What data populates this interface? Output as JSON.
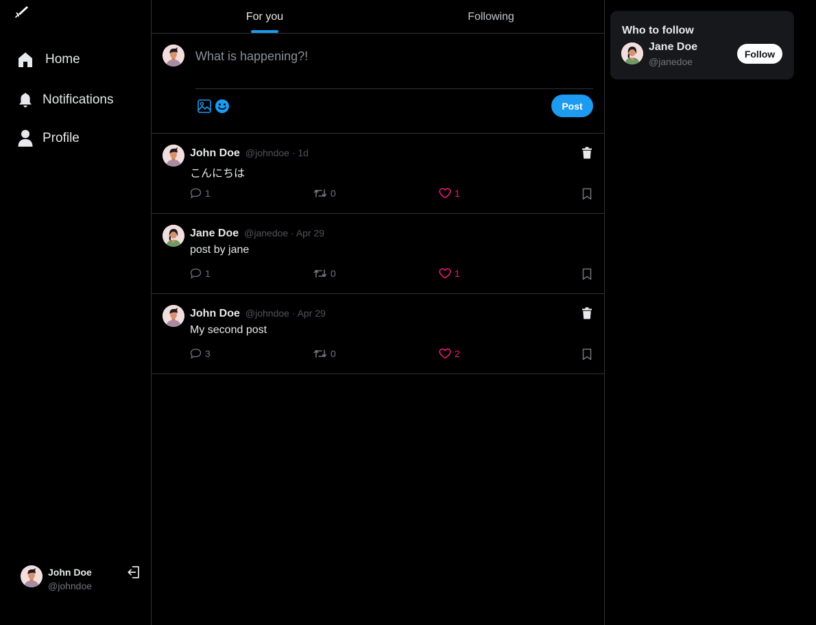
{
  "sidebar": {
    "logo_icon": "quill-icon",
    "nav": {
      "home": "Home",
      "notifications": "Notifications",
      "profile": "Profile"
    },
    "current_user": {
      "name": "John Doe",
      "handle": "@johndoe"
    }
  },
  "tabs": {
    "for_you": "For you",
    "following": "Following",
    "active": "For you"
  },
  "composer": {
    "placeholder": "What is happening?!",
    "post_label": "Post"
  },
  "posts": [
    {
      "name": "John Doe",
      "meta": "@johndoe · 1d",
      "text": "こんにちは",
      "replies": "1",
      "reposts": "0",
      "likes": "1",
      "deletable": true,
      "liked": true
    },
    {
      "name": "Jane Doe",
      "meta": "@janedoe · Apr 29",
      "text": "post by jane",
      "replies": "1",
      "reposts": "0",
      "likes": "1",
      "deletable": false,
      "liked": true
    },
    {
      "name": "John Doe",
      "meta": "@johndoe · Apr 29",
      "text": "My second post",
      "replies": "3",
      "reposts": "0",
      "likes": "2",
      "deletable": true,
      "liked": true
    }
  ],
  "who_to_follow": {
    "title": "Who to follow",
    "users": [
      {
        "name": "Jane Doe",
        "handle": "@janedoe",
        "button_label": "Follow"
      }
    ]
  },
  "colors": {
    "accent": "#1d9bf0",
    "like": "#f91880",
    "background": "#000000",
    "panel": "#16181c",
    "border": "#2f3336"
  }
}
